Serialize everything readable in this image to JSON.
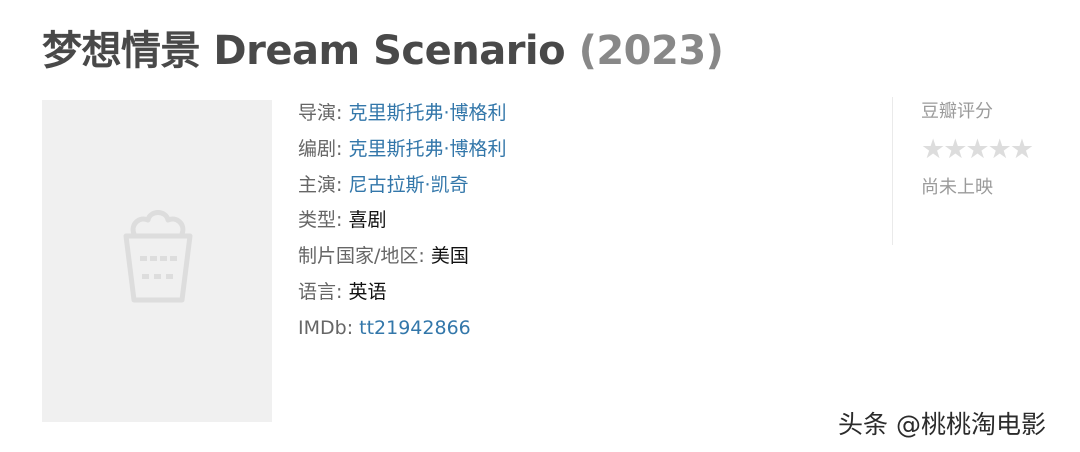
{
  "header": {
    "title_main": "梦想情景 Dream Scenario",
    "title_year": "(2023)"
  },
  "info": {
    "director_label": "导演:",
    "director": "克里斯托弗·博格利",
    "writer_label": "编剧:",
    "writer": "克里斯托弗·博格利",
    "cast_label": "主演:",
    "cast": "尼古拉斯·凯奇",
    "genre_label": "类型:",
    "genre": "喜剧",
    "country_label": "制片国家/地区:",
    "country": "美国",
    "language_label": "语言:",
    "language": "英语",
    "imdb_label": "IMDb:",
    "imdb": "tt21942866"
  },
  "rating": {
    "label": "豆瓣评分",
    "stars": "★★★★★",
    "status": "尚未上映"
  },
  "watermark": "头条 @桃桃淘电影",
  "icons": {
    "poster_placeholder": "popcorn-icon"
  }
}
